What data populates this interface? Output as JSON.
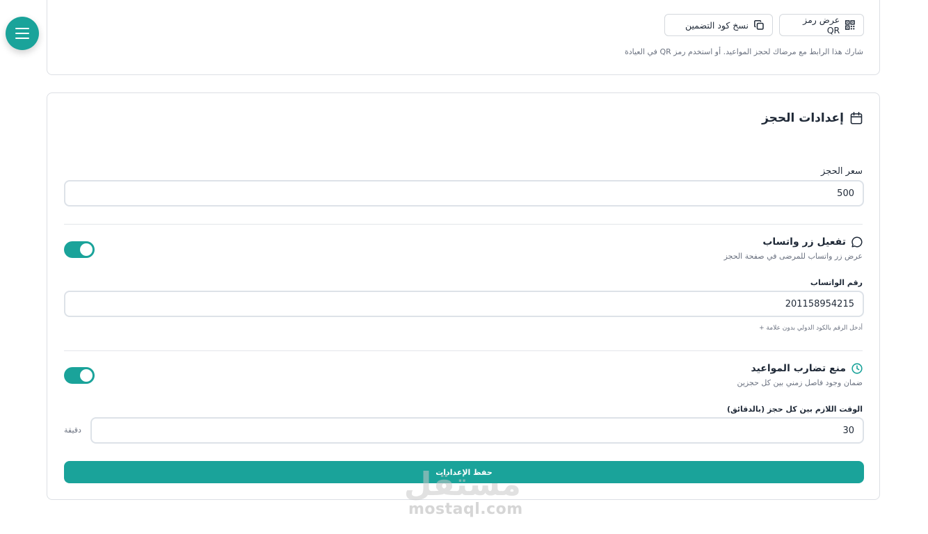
{
  "top_card": {
    "qr_button_label": "عرض رمز QR",
    "embed_button_label": "نسخ كود التضمين",
    "share_hint": "شارك هذا الرابط مع مرضاك لحجز المواعيد. أو استخدم رمز QR في العيادة"
  },
  "booking_settings": {
    "title": "إعدادات الحجز",
    "price_label": "سعر الحجز",
    "price_value": "500",
    "whatsapp": {
      "title": "تفعيل زر واتساب",
      "description": "عرض زر واتساب للمرضى في صفحة الحجز",
      "enabled": true,
      "number_label": "رقم الواتساب",
      "number_value": "201158954215",
      "number_hint": "أدخل الرقم بالكود الدولي بدون علامة +"
    },
    "conflict": {
      "title": "منع تضارب المواعيد",
      "description": "ضمان وجود فاصل زمني بين كل حجزين",
      "enabled": true,
      "gap_label": "الوقت اللازم بين كل حجز (بالدقائق)",
      "gap_value": "30",
      "gap_unit": "دقيقة"
    },
    "save_label": "حفظ الإعدادات"
  },
  "watermark": {
    "logo_text": "مستقل",
    "url": "mostaql.com"
  },
  "colors": {
    "accent": "#1aa39a",
    "border": "#dcdfe4",
    "muted_text": "#6b7280"
  },
  "icons": [
    "menu-icon",
    "qr-code-icon",
    "copy-icon",
    "calendar-icon",
    "chat-icon",
    "clock-icon"
  ]
}
